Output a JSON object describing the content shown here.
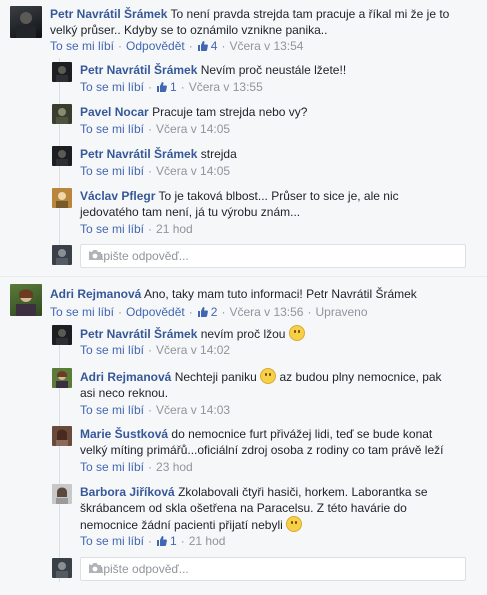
{
  "threads": [
    {
      "comment": {
        "author": "Petr Navrátil Šrámek",
        "text_line1": "To není pravda strejda tam pracuje a říkal mi že je to",
        "text_line2": "velký průser.. Kdyby se to oznámilo vznikne panika..",
        "like": "To se mi líbí",
        "reply": "Odpovědět",
        "likes": "4",
        "time": "Včera v 13:54"
      },
      "replies": [
        {
          "author": "Petr Navrátil Šrámek",
          "text": "Nevím proč neustále lžete!!",
          "like": "To se mi líbí",
          "likes": "1",
          "time": "Včera v 13:55"
        },
        {
          "author": "Pavel Nocar",
          "text": "Pracuje tam strejda nebo vy?",
          "like": "To se mi líbí",
          "time": "Včera v 14:05"
        },
        {
          "author": "Petr Navrátil Šrámek",
          "text": "strejda",
          "like": "To se mi líbí",
          "time": "Včera v 14:05"
        },
        {
          "author": "Václav Pflegr",
          "text_line1": "To je taková blbost... Průser to sice je, ale nic",
          "text_line2": "jedovatého tam není, já tu výrobu znám...",
          "like": "To se mi líbí",
          "time": "21 hod"
        }
      ],
      "reply_placeholder": "Napište odpověď..."
    },
    {
      "comment": {
        "author": "Adri Rejmanová",
        "text": "Ano, taky mam tuto informaci! Petr Navrátil Šrámek",
        "like": "To se mi líbí",
        "reply": "Odpovědět",
        "likes": "2",
        "time": "Včera v 13:56",
        "edited": "Upraveno"
      },
      "replies": [
        {
          "author": "Petr Navrátil Šrámek",
          "text": "nevím proč lžou",
          "like": "To se mi líbí",
          "time": "Včera v 14:02"
        },
        {
          "author": "Adri Rejmanová",
          "text_line1": "Nechteji paniku",
          "text_line1b": "az budou plny nemocnice, pak",
          "text_line2": "asi neco reknou.",
          "like": "To se mi líbí",
          "time": "Včera v 14:03"
        },
        {
          "author": "Marie Šustková",
          "text_line1": "do nemocnice furt přivážej lidi, teď se bude konat",
          "text_line2": "velký míting primářů...oficiální zdroj osoba z rodiny co tam právě leží",
          "like": "To se mi líbí",
          "time": "23 hod"
        },
        {
          "author": "Barbora Jiříková",
          "text_line1": "Zkolabovali čtyři hasiči, horkem. Laborantka se",
          "text_line2": "škrábancem od skla ošetřena na Paracelsu. Z této havárie do",
          "text_line3": "nemocnice žádní pacienti přijatí nebyli",
          "like": "To se mi líbí",
          "likes": "1",
          "time": "21 hod"
        }
      ],
      "reply_placeholder": "Napište odpověď..."
    }
  ],
  "colors": {
    "author": "#365899",
    "link": "#4267b2",
    "meta": "#90949c",
    "bg": "#f6f7f9"
  },
  "icons": [
    "thumbs-up-icon",
    "camera-icon",
    "smiley-icon",
    "wink-icon"
  ]
}
